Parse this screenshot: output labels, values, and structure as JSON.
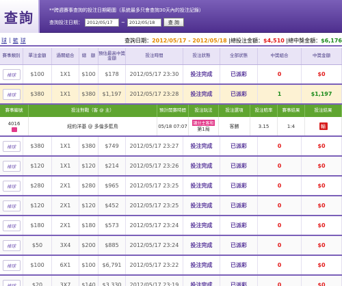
{
  "header": {
    "title": "查詢",
    "note": "**跨週賽事查詢的投注日期範圍（系統最多只會查詢30天內的投注記錄）",
    "search_label": "查詢投注日期：",
    "date_from": "2012/05/17",
    "date_to": "2012/05/18",
    "separator": "~",
    "query_button": "查 詢"
  },
  "tabs": [
    "球",
    "籃",
    "球"
  ],
  "summary": {
    "prefix": "查詢日期：",
    "dates": "2012/05/17 - 2012/05/18",
    "total_label": "總投注金額：",
    "total_value": "$4,510",
    "win_label": "總中獎金額：",
    "win_value": "$6,176"
  },
  "columns": [
    "賽事類別",
    "單注金額",
    "過關組合",
    "總　額",
    "預估最高中獎金額",
    "投注時間",
    "投注狀態",
    "全部狀態",
    "中獎組合",
    "中獎金額"
  ],
  "rows": [
    {
      "logo": "棒球",
      "amount": "$100",
      "combo": "1X1",
      "total": "$100",
      "max": "$178",
      "time": "2012/05/17 23:30",
      "status": "投注完成",
      "state": "已派彩",
      "win_combo": "0",
      "win": "$0",
      "win_combo_color": "red",
      "highlight": false
    },
    {
      "logo": "棒球",
      "amount": "$380",
      "combo": "1X1",
      "total": "$380",
      "max": "$1,197",
      "time": "2012/05/17 23:28",
      "status": "投注完成",
      "state": "已派彩",
      "win_combo": "1",
      "win": "$1,197",
      "win_combo_color": "green",
      "highlight": true
    },
    {
      "logo": "棒球",
      "amount": "$380",
      "combo": "1X1",
      "total": "$380",
      "max": "$749",
      "time": "2012/05/17 23:27",
      "status": "投注完成",
      "state": "已派彩",
      "win_combo": "0",
      "win": "$0",
      "win_combo_color": "red",
      "highlight": false
    },
    {
      "logo": "棒球",
      "amount": "$120",
      "combo": "1X1",
      "total": "$120",
      "max": "$214",
      "time": "2012/05/17 23:26",
      "status": "投注完成",
      "state": "已派彩",
      "win_combo": "0",
      "win": "$0",
      "win_combo_color": "red",
      "highlight": false
    },
    {
      "logo": "棒球",
      "amount": "$280",
      "combo": "2X1",
      "total": "$280",
      "max": "$965",
      "time": "2012/05/17 23:25",
      "status": "投注完成",
      "state": "已派彩",
      "win_combo": "0",
      "win": "$0",
      "win_combo_color": "red",
      "highlight": false
    },
    {
      "logo": "棒球",
      "amount": "$120",
      "combo": "2X1",
      "total": "$120",
      "max": "$452",
      "time": "2012/05/17 23:25",
      "status": "投注完成",
      "state": "已派彩",
      "win_combo": "0",
      "win": "$0",
      "win_combo_color": "red",
      "highlight": false
    },
    {
      "logo": "棒球",
      "amount": "$180",
      "combo": "2X1",
      "total": "$180",
      "max": "$573",
      "time": "2012/05/17 23:24",
      "status": "投注完成",
      "state": "已派彩",
      "win_combo": "0",
      "win": "$0",
      "win_combo_color": "red",
      "highlight": false
    },
    {
      "logo": "棒球",
      "amount": "$50",
      "combo": "3X4",
      "total": "$200",
      "max": "$885",
      "time": "2012/05/17 23:24",
      "status": "投注完成",
      "state": "已派彩",
      "win_combo": "0",
      "win": "$0",
      "win_combo_color": "red",
      "highlight": false
    },
    {
      "logo": "棒球",
      "amount": "$100",
      "combo": "6X1",
      "total": "$100",
      "max": "$6,791",
      "time": "2012/05/17 23:22",
      "status": "投注完成",
      "state": "已派彩",
      "win_combo": "0",
      "win": "$0",
      "win_combo_color": "red",
      "highlight": false
    },
    {
      "logo": "棒球",
      "amount": "$20",
      "combo": "3X7",
      "total": "$140",
      "max": "$3,330",
      "time": "2012/05/17 23:19",
      "status": "投注完成",
      "state": "已派彩",
      "win_combo": "0",
      "win": "$0",
      "win_combo_color": "red",
      "highlight": false
    }
  ],
  "detail": {
    "columns": [
      "賽事編號",
      "投注對戰（客 @ 主）",
      "預計開賽時間",
      "投注玩法",
      "投注選項",
      "投注賠率",
      "賽事結果",
      "投注結果"
    ],
    "id": "4016",
    "match": "紐約洋基 @ 多倫多藍鳥",
    "time": "05/18 07:07",
    "content_tag": "讓分主客和",
    "content_sub": "第1局",
    "pick": "客勝",
    "odds": "3.15",
    "score": "1:4",
    "result": "輸"
  },
  "colors": {
    "header": "#4e2f8e",
    "accent": "#7a5fb8",
    "detail_header": "#5fa530",
    "lose": "#e21b1b",
    "win": "#1a8a1a",
    "highlight_row": "#fdf2d3"
  }
}
